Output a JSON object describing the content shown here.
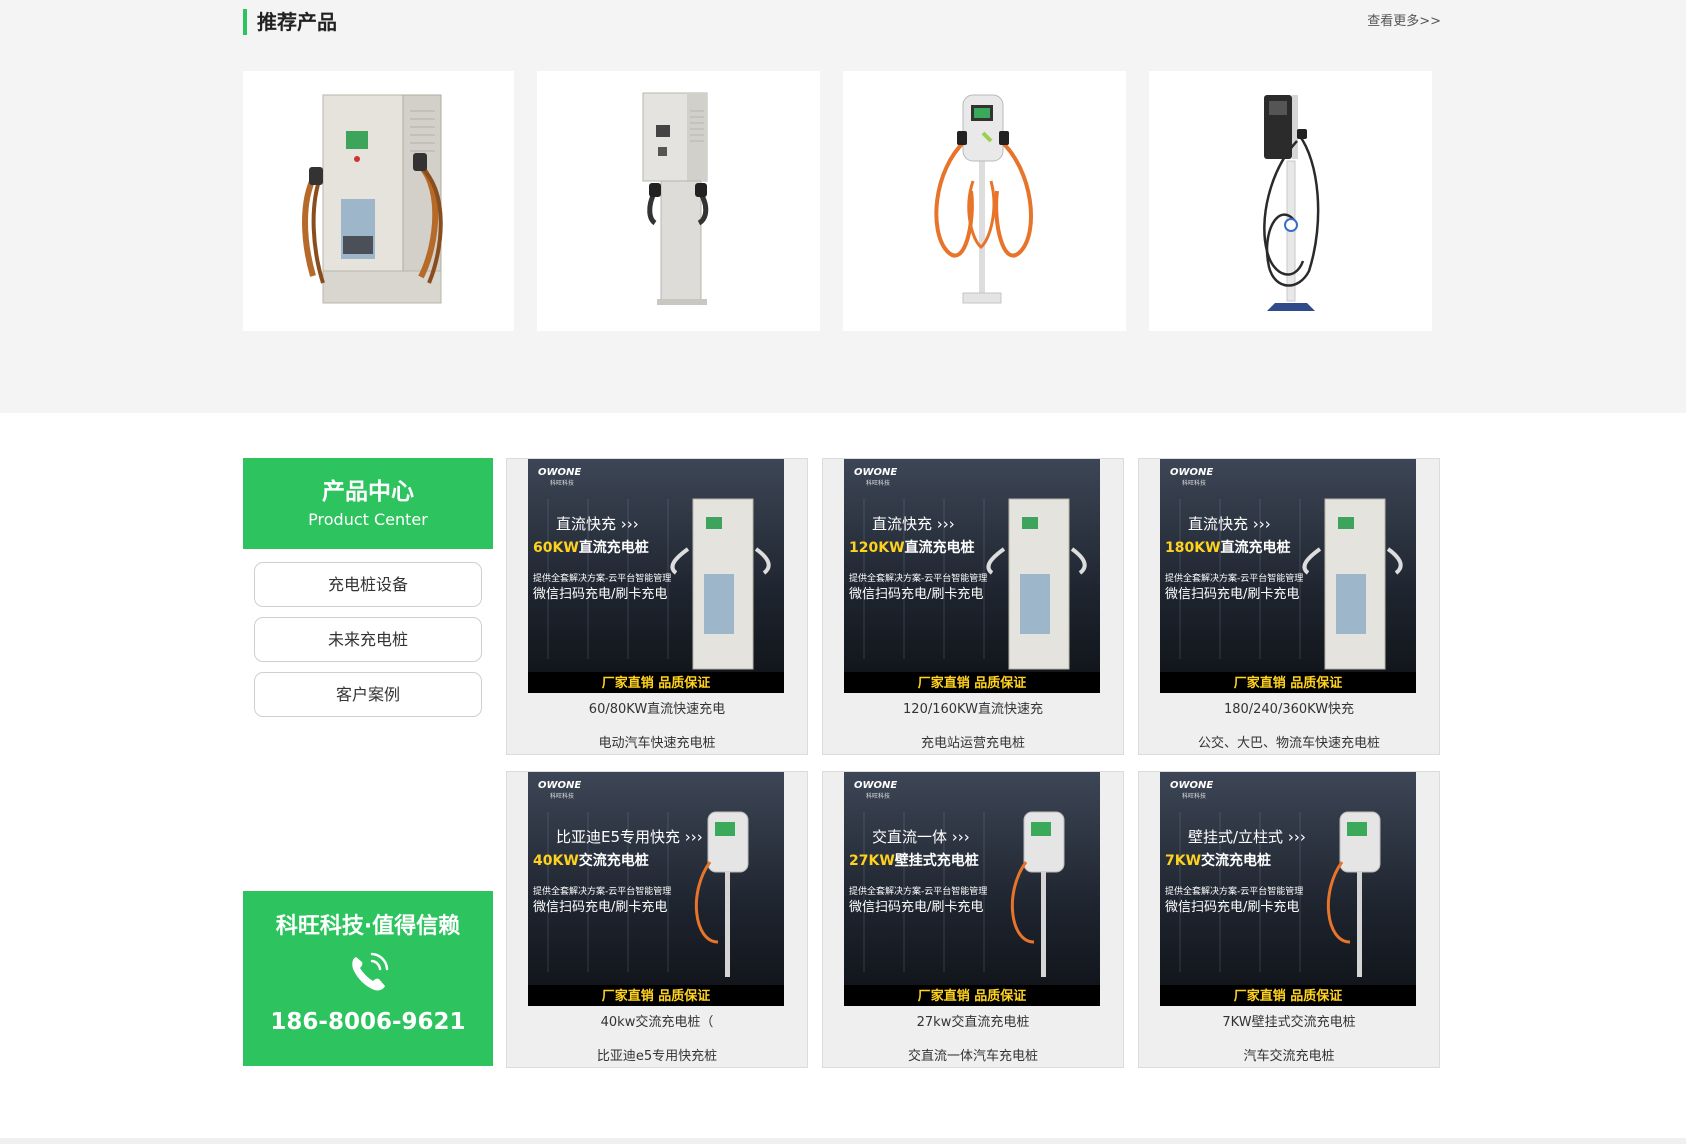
{
  "recommend": {
    "title": "推荐产品",
    "more": "查看更多>>"
  },
  "sidebar": {
    "title_cn": "产品中心",
    "title_en": "Product Center",
    "items": [
      {
        "label": "充电桩设备"
      },
      {
        "label": "未来充电桩"
      },
      {
        "label": "客户案例"
      }
    ],
    "slogan": "科旺科技·值得信赖",
    "phone": "186-8006-9621"
  },
  "banner_common": {
    "brand": "OWONE",
    "brand_cn": "科旺科技",
    "line_a": "提供全套解决方案-云平台智能管理",
    "line_b": "微信扫码充电/刷卡充电",
    "footer": "厂家直销  品质保证"
  },
  "products": [
    {
      "head": "直流快充",
      "power": "60KW",
      "kind": "直流充电桩",
      "name": "60/80KW直流快速充电",
      "sub": "电动汽车快速充电桩"
    },
    {
      "head": "直流快充",
      "power": "120KW",
      "kind": "直流充电桩",
      "name": "120/160KW直流快速充",
      "sub": "充电站运营充电桩"
    },
    {
      "head": "直流快充",
      "power": "180KW",
      "kind": "直流充电桩",
      "name": "180/240/360KW快充",
      "sub": "公交、大巴、物流车快速充电桩"
    },
    {
      "head": "比亚迪E5专用快充",
      "power": "40KW",
      "kind": "交流充电桩",
      "name": "40kw交流充电桩（",
      "sub": "比亚迪e5专用快充桩"
    },
    {
      "head": "交直流一体",
      "power": "27KW",
      "kind": "壁挂式充电桩",
      "name": "27kw交直流充电桩",
      "sub": "交直流一体汽车充电桩"
    },
    {
      "head": "壁挂式/立柱式",
      "power": "7KW",
      "kind": "交流充电桩",
      "name": "7KW壁挂式交流充电桩",
      "sub": "汽车交流充电桩"
    }
  ],
  "colors": {
    "accent": "#2dc35f",
    "banner_power": "#ffd21e",
    "banner_bg": "#1f2530"
  }
}
